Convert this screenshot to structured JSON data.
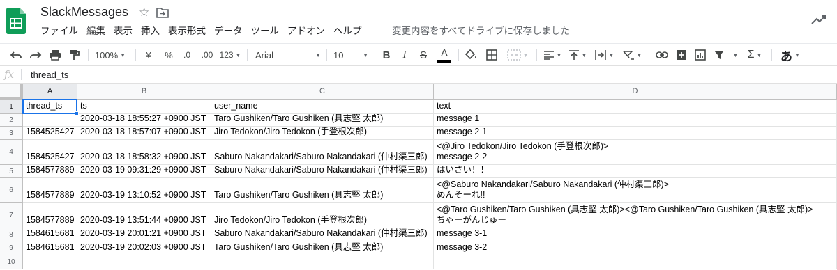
{
  "app": {
    "title": "SlackMessages",
    "save_status": "変更内容をすべてドライブに保存しました",
    "brand_color": "#0f9d58"
  },
  "menu": [
    "ファイル",
    "編集",
    "表示",
    "挿入",
    "表示形式",
    "データ",
    "ツール",
    "アドオン",
    "ヘルプ"
  ],
  "toolbar": {
    "zoom": "100%",
    "currency": "¥",
    "percent": "%",
    "decimal_decrease": ".0",
    "decimal_increase": ".00",
    "more_formats": "123",
    "font": "Arial",
    "font_size": "10",
    "bold": "B",
    "italic": "I",
    "strike": "S",
    "text_color": "A",
    "sigma": "Σ",
    "input_tool": "あ"
  },
  "formula_bar": {
    "label": "fx",
    "value": "thread_ts"
  },
  "columns": [
    "A",
    "B",
    "C",
    "D"
  ],
  "rows": [
    {
      "num": "1",
      "cells": [
        "thread_ts",
        "ts",
        "user_name",
        "text"
      ]
    },
    {
      "num": "2",
      "cells": [
        "",
        "2020-03-18 18:55:27 +0900 JST",
        "Taro Gushiken/Taro Gushiken (具志堅 太郎)",
        "message 1"
      ]
    },
    {
      "num": "3",
      "cells": [
        "1584525427",
        "2020-03-18 18:57:07 +0900 JST",
        "Jiro Tedokon/Jiro Tedokon (手登根次郎)",
        "message 2-1"
      ]
    },
    {
      "num": "4",
      "cells": [
        "1584525427",
        "2020-03-18 18:58:32 +0900 JST",
        "Saburo Nakandakari/Saburo Nakandakari (仲村渠三郎)",
        "<@Jiro Tedokon/Jiro Tedokon (手登根次郎)>\nmessage 2-2"
      ]
    },
    {
      "num": "5",
      "cells": [
        "1584577889",
        "2020-03-19 09:31:29 +0900 JST",
        "Saburo Nakandakari/Saburo Nakandakari (仲村渠三郎)",
        "はいさい！！"
      ]
    },
    {
      "num": "6",
      "cells": [
        "1584577889",
        "2020-03-19 13:10:52 +0900 JST",
        "Taro Gushiken/Taro Gushiken (具志堅 太郎)",
        "<@Saburo Nakandakari/Saburo Nakandakari (仲村渠三郎)>\nめんそーれ!!"
      ]
    },
    {
      "num": "7",
      "cells": [
        "1584577889",
        "2020-03-19 13:51:44 +0900 JST",
        "Jiro Tedokon/Jiro Tedokon (手登根次郎)",
        "<@Taro Gushiken/Taro Gushiken (具志堅 太郎)><@Taro Gushiken/Taro Gushiken (具志堅 太郎)>\nちゃーがんじゅー"
      ]
    },
    {
      "num": "8",
      "cells": [
        "1584615681",
        "2020-03-19 20:01:21 +0900 JST",
        "Saburo Nakandakari/Saburo Nakandakari (仲村渠三郎)",
        "message 3-1"
      ]
    },
    {
      "num": "9",
      "cells": [
        "1584615681",
        "2020-03-19 20:02:03 +0900 JST",
        "Taro Gushiken/Taro Gushiken (具志堅 太郎)",
        "message 3-2"
      ]
    },
    {
      "num": "10",
      "cells": [
        "",
        "",
        "",
        ""
      ]
    }
  ]
}
